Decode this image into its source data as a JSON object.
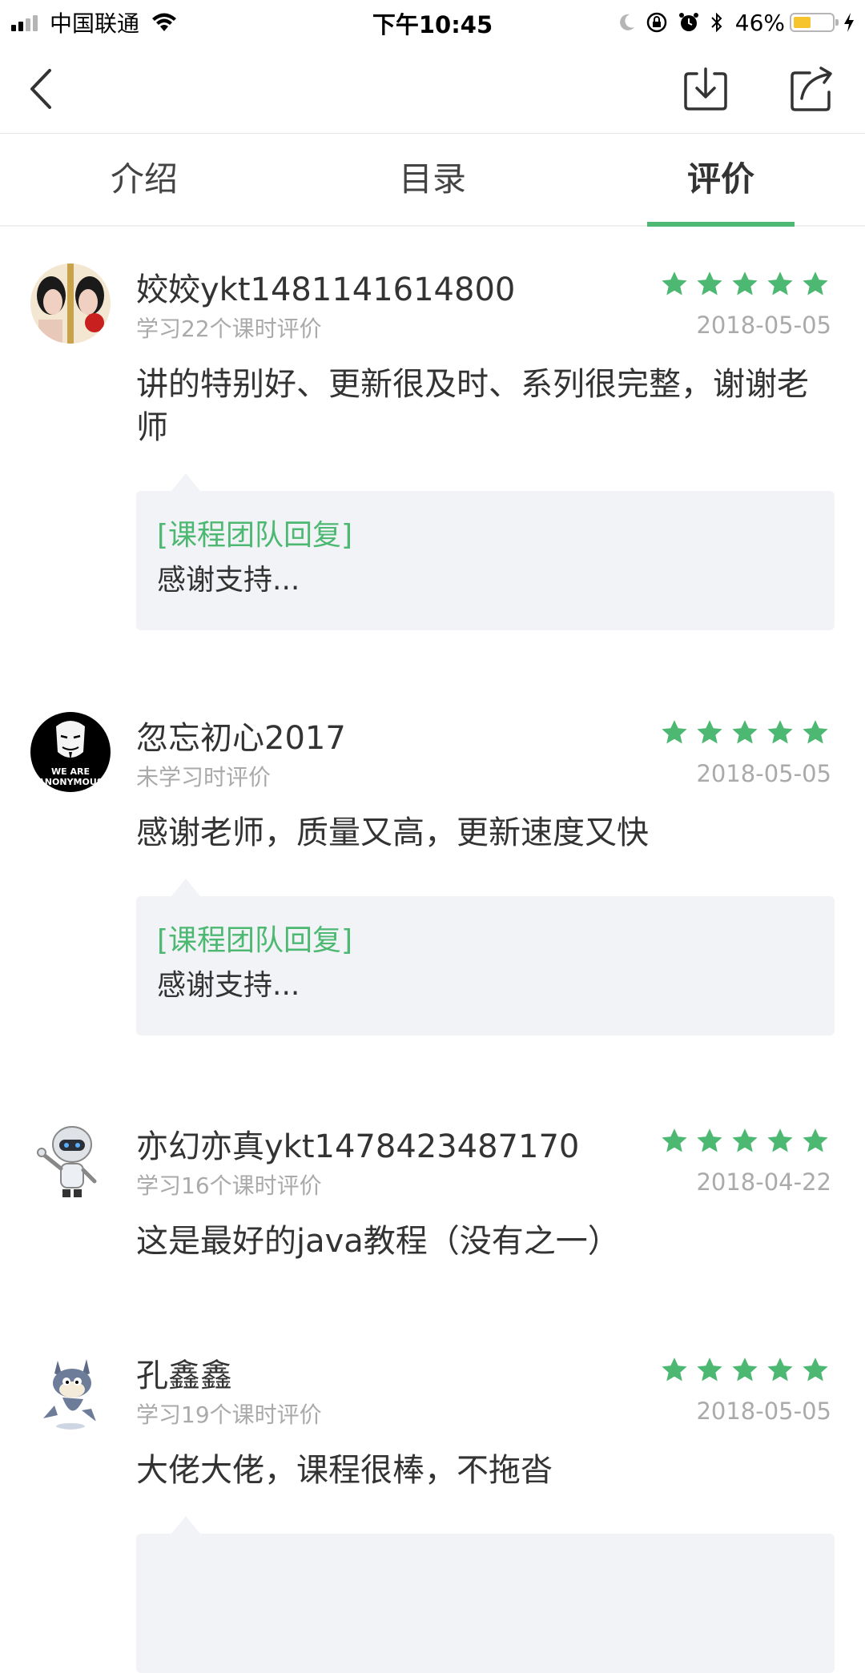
{
  "status_bar": {
    "carrier": "中国联通",
    "time": "下午10:45",
    "battery_percent": "46%",
    "battery_level": 0.46,
    "battery_color": "#f6c42c",
    "icons": [
      "signal-icon",
      "wifi-icon",
      "moon-icon",
      "rotation-lock-icon",
      "alarm-icon",
      "bluetooth-icon",
      "battery-icon",
      "charging-icon"
    ]
  },
  "nav": {
    "icons": [
      "back-icon",
      "download-icon",
      "share-icon"
    ]
  },
  "tabs": [
    {
      "label": "介绍",
      "active": false
    },
    {
      "label": "目录",
      "active": false
    },
    {
      "label": "评价",
      "active": true
    }
  ],
  "colors": {
    "accent": "#4cb872",
    "star": "#4cb872",
    "reply_bg": "#f2f3f7",
    "secondary_text": "#aaaaaa"
  },
  "reviews": [
    {
      "name": "姣姣ykt1481141614800",
      "sub": "学习22个课时评价",
      "rating": 5,
      "date": "2018-05-05",
      "content": "讲的特别好、更新很及时、系列很完整，谢谢老师",
      "reply_label": "[课程团队回复]",
      "reply_text": "感谢支持..."
    },
    {
      "name": "忽忘初心2017",
      "sub": "未学习时评价",
      "rating": 5,
      "date": "2018-05-05",
      "content": "感谢老师，质量又高，更新速度又快",
      "reply_label": "[课程团队回复]",
      "reply_text": "感谢支持...",
      "avatar_text_1": "WE ARE",
      "avatar_text_2": "ANONYMOUS"
    },
    {
      "name": "亦幻亦真ykt1478423487170",
      "sub": "学习16个课时评价",
      "rating": 5,
      "date": "2018-04-22",
      "content": "这是最好的java教程（没有之一）"
    },
    {
      "name": "孔鑫鑫",
      "sub": "学习19个课时评价",
      "rating": 5,
      "date": "2018-05-05",
      "content": "大佬大佬，课程很棒，不拖沓"
    }
  ]
}
